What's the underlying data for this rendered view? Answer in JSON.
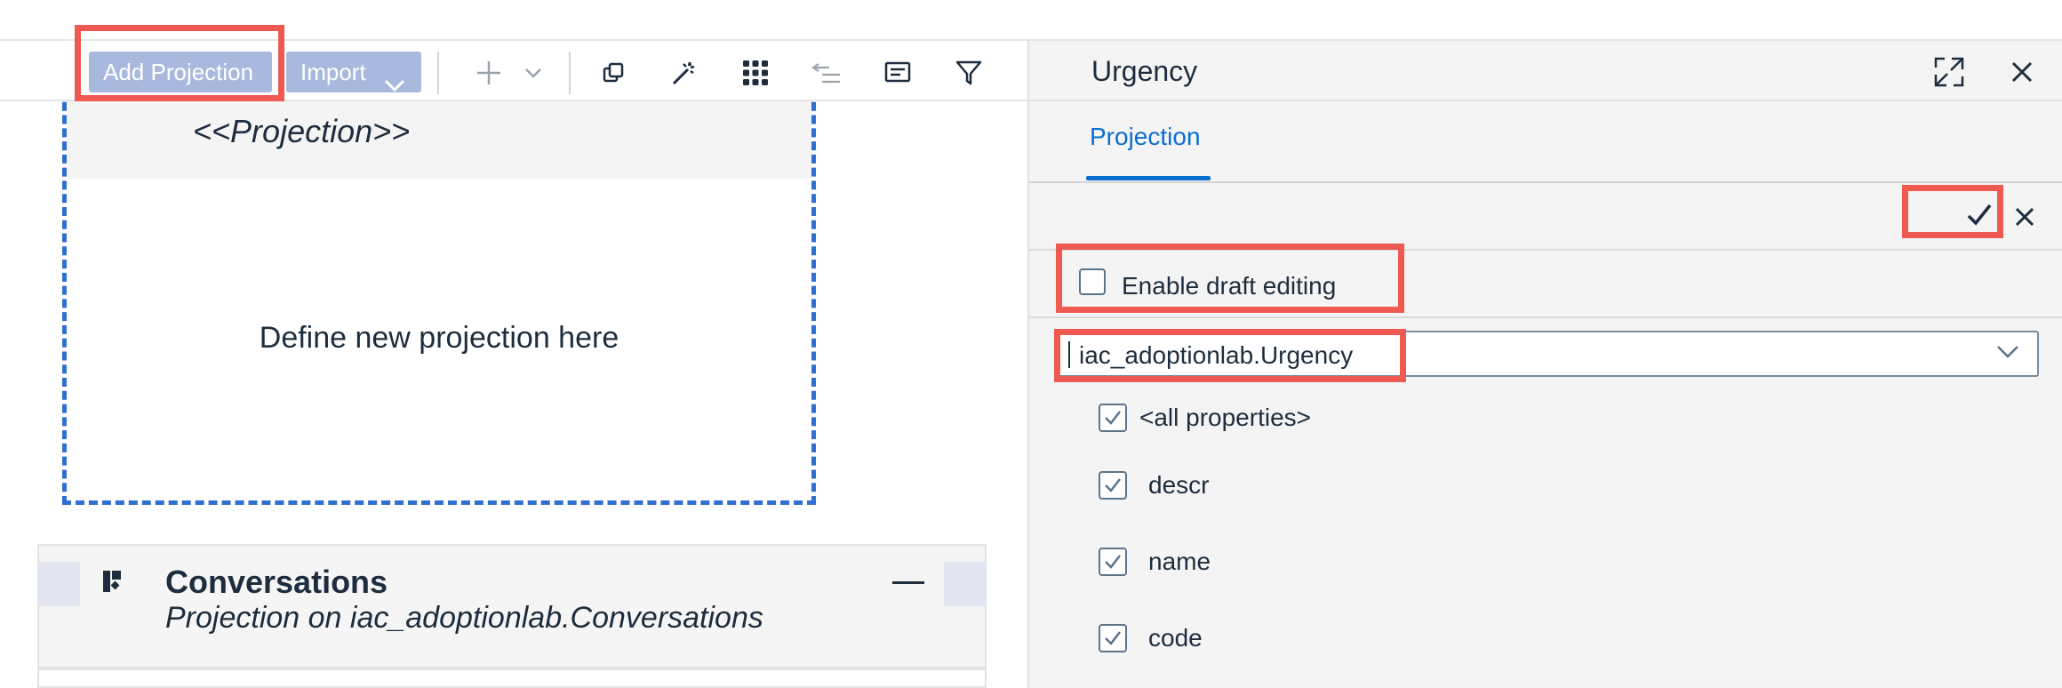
{
  "toolbar": {
    "add_projection_label": "Add Projection",
    "import_label": "Import",
    "icons": [
      "plus-icon",
      "chevron-down-icon",
      "copy-icon",
      "magic-wand-icon",
      "grid-icon",
      "indent-icon",
      "comment-icon",
      "filter-icon"
    ]
  },
  "canvas": {
    "projection_card": {
      "stereotype": "<<Projection>>",
      "placeholder": "Define new projection here"
    },
    "conversations_card": {
      "name": "Conversations",
      "subtitle": "Projection on iac_adoptionlab.Conversations"
    }
  },
  "panel": {
    "title": "Urgency",
    "tabs": [
      {
        "label": "Projection",
        "selected": true
      }
    ],
    "draft_editing": {
      "label": "Enable draft editing",
      "checked": false
    },
    "entity_select": {
      "value": "iac_adoptionlab.Urgency"
    },
    "properties": [
      {
        "label": "<all properties>",
        "checked": true
      },
      {
        "label": "descr",
        "checked": true
      },
      {
        "label": "name",
        "checked": true
      },
      {
        "label": "code",
        "checked": true
      }
    ]
  },
  "colors": {
    "accent": "#0a6ed1",
    "highlight": "#ee5a52",
    "dashed_border": "#2f6fd1",
    "button_bg": "#a9b9de"
  }
}
